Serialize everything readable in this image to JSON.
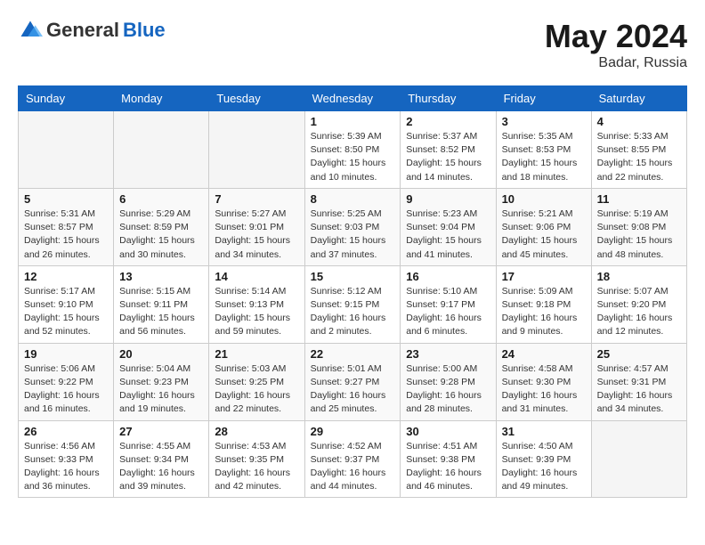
{
  "header": {
    "logo_general": "General",
    "logo_blue": "Blue",
    "month_year": "May 2024",
    "location": "Badar, Russia"
  },
  "days_of_week": [
    "Sunday",
    "Monday",
    "Tuesday",
    "Wednesday",
    "Thursday",
    "Friday",
    "Saturday"
  ],
  "weeks": [
    [
      {
        "day": "",
        "info": ""
      },
      {
        "day": "",
        "info": ""
      },
      {
        "day": "",
        "info": ""
      },
      {
        "day": "1",
        "info": "Sunrise: 5:39 AM\nSunset: 8:50 PM\nDaylight: 15 hours\nand 10 minutes."
      },
      {
        "day": "2",
        "info": "Sunrise: 5:37 AM\nSunset: 8:52 PM\nDaylight: 15 hours\nand 14 minutes."
      },
      {
        "day": "3",
        "info": "Sunrise: 5:35 AM\nSunset: 8:53 PM\nDaylight: 15 hours\nand 18 minutes."
      },
      {
        "day": "4",
        "info": "Sunrise: 5:33 AM\nSunset: 8:55 PM\nDaylight: 15 hours\nand 22 minutes."
      }
    ],
    [
      {
        "day": "5",
        "info": "Sunrise: 5:31 AM\nSunset: 8:57 PM\nDaylight: 15 hours\nand 26 minutes."
      },
      {
        "day": "6",
        "info": "Sunrise: 5:29 AM\nSunset: 8:59 PM\nDaylight: 15 hours\nand 30 minutes."
      },
      {
        "day": "7",
        "info": "Sunrise: 5:27 AM\nSunset: 9:01 PM\nDaylight: 15 hours\nand 34 minutes."
      },
      {
        "day": "8",
        "info": "Sunrise: 5:25 AM\nSunset: 9:03 PM\nDaylight: 15 hours\nand 37 minutes."
      },
      {
        "day": "9",
        "info": "Sunrise: 5:23 AM\nSunset: 9:04 PM\nDaylight: 15 hours\nand 41 minutes."
      },
      {
        "day": "10",
        "info": "Sunrise: 5:21 AM\nSunset: 9:06 PM\nDaylight: 15 hours\nand 45 minutes."
      },
      {
        "day": "11",
        "info": "Sunrise: 5:19 AM\nSunset: 9:08 PM\nDaylight: 15 hours\nand 48 minutes."
      }
    ],
    [
      {
        "day": "12",
        "info": "Sunrise: 5:17 AM\nSunset: 9:10 PM\nDaylight: 15 hours\nand 52 minutes."
      },
      {
        "day": "13",
        "info": "Sunrise: 5:15 AM\nSunset: 9:11 PM\nDaylight: 15 hours\nand 56 minutes."
      },
      {
        "day": "14",
        "info": "Sunrise: 5:14 AM\nSunset: 9:13 PM\nDaylight: 15 hours\nand 59 minutes."
      },
      {
        "day": "15",
        "info": "Sunrise: 5:12 AM\nSunset: 9:15 PM\nDaylight: 16 hours\nand 2 minutes."
      },
      {
        "day": "16",
        "info": "Sunrise: 5:10 AM\nSunset: 9:17 PM\nDaylight: 16 hours\nand 6 minutes."
      },
      {
        "day": "17",
        "info": "Sunrise: 5:09 AM\nSunset: 9:18 PM\nDaylight: 16 hours\nand 9 minutes."
      },
      {
        "day": "18",
        "info": "Sunrise: 5:07 AM\nSunset: 9:20 PM\nDaylight: 16 hours\nand 12 minutes."
      }
    ],
    [
      {
        "day": "19",
        "info": "Sunrise: 5:06 AM\nSunset: 9:22 PM\nDaylight: 16 hours\nand 16 minutes."
      },
      {
        "day": "20",
        "info": "Sunrise: 5:04 AM\nSunset: 9:23 PM\nDaylight: 16 hours\nand 19 minutes."
      },
      {
        "day": "21",
        "info": "Sunrise: 5:03 AM\nSunset: 9:25 PM\nDaylight: 16 hours\nand 22 minutes."
      },
      {
        "day": "22",
        "info": "Sunrise: 5:01 AM\nSunset: 9:27 PM\nDaylight: 16 hours\nand 25 minutes."
      },
      {
        "day": "23",
        "info": "Sunrise: 5:00 AM\nSunset: 9:28 PM\nDaylight: 16 hours\nand 28 minutes."
      },
      {
        "day": "24",
        "info": "Sunrise: 4:58 AM\nSunset: 9:30 PM\nDaylight: 16 hours\nand 31 minutes."
      },
      {
        "day": "25",
        "info": "Sunrise: 4:57 AM\nSunset: 9:31 PM\nDaylight: 16 hours\nand 34 minutes."
      }
    ],
    [
      {
        "day": "26",
        "info": "Sunrise: 4:56 AM\nSunset: 9:33 PM\nDaylight: 16 hours\nand 36 minutes."
      },
      {
        "day": "27",
        "info": "Sunrise: 4:55 AM\nSunset: 9:34 PM\nDaylight: 16 hours\nand 39 minutes."
      },
      {
        "day": "28",
        "info": "Sunrise: 4:53 AM\nSunset: 9:35 PM\nDaylight: 16 hours\nand 42 minutes."
      },
      {
        "day": "29",
        "info": "Sunrise: 4:52 AM\nSunset: 9:37 PM\nDaylight: 16 hours\nand 44 minutes."
      },
      {
        "day": "30",
        "info": "Sunrise: 4:51 AM\nSunset: 9:38 PM\nDaylight: 16 hours\nand 46 minutes."
      },
      {
        "day": "31",
        "info": "Sunrise: 4:50 AM\nSunset: 9:39 PM\nDaylight: 16 hours\nand 49 minutes."
      },
      {
        "day": "",
        "info": ""
      }
    ]
  ]
}
